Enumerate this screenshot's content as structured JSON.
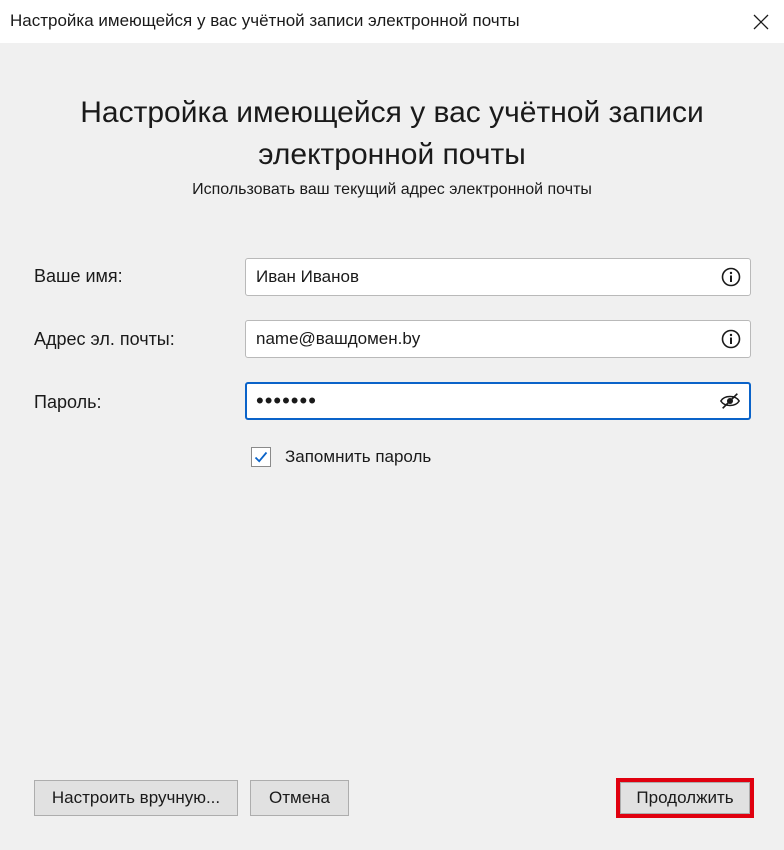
{
  "window": {
    "title": "Настройка имеющейся у вас учётной записи электронной почты"
  },
  "header": {
    "title_line1": "Настройка имеющейся у вас учётной записи",
    "title_line2": "электронной почты",
    "subtitle": "Использовать ваш текущий адрес электронной почты"
  },
  "form": {
    "name_label": "Ваше имя:",
    "name_value": "Иван Иванов",
    "email_label": "Адрес эл. почты:",
    "email_value": "name@вашдомен.by",
    "password_label": "Пароль:",
    "password_value": "•••••••",
    "remember_label": "Запомнить пароль",
    "remember_checked": true
  },
  "buttons": {
    "manual": "Настроить вручную...",
    "cancel": "Отмена",
    "continue": "Продолжить"
  },
  "colors": {
    "focus_border": "#0a63c9",
    "highlight": "#e0000f",
    "checkmark": "#0a63c9"
  },
  "icons": {
    "name_field": "info-icon",
    "email_field": "info-icon",
    "password_field": "eye-slash-icon",
    "close": "close-icon"
  }
}
